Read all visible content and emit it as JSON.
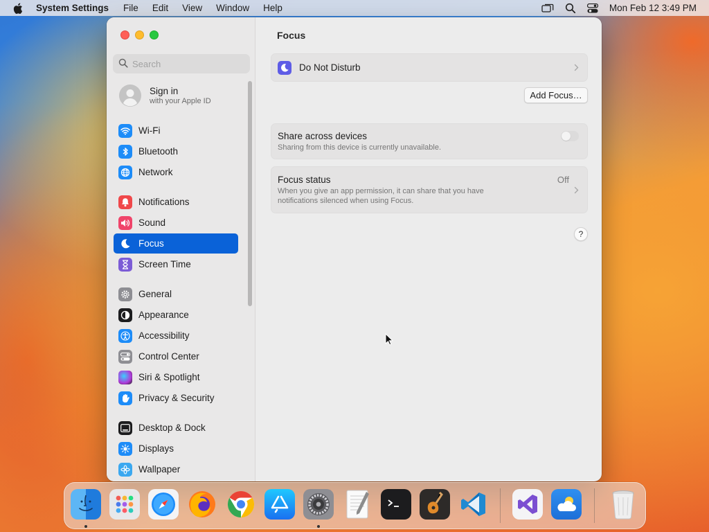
{
  "menubar": {
    "app_name": "System Settings",
    "menus": [
      "File",
      "Edit",
      "View",
      "Window",
      "Help"
    ],
    "clock": "Mon Feb 12  3:49 PM"
  },
  "sidebar": {
    "search_placeholder": "Search",
    "signin": {
      "title": "Sign in",
      "subtitle": "with your Apple ID"
    },
    "items": [
      {
        "label": "Wi-Fi",
        "icon": "wifi-icon",
        "color": "#1d8cf8"
      },
      {
        "label": "Bluetooth",
        "icon": "bluetooth-icon",
        "color": "#1d8cf8"
      },
      {
        "label": "Network",
        "icon": "globe-icon",
        "color": "#1d8cf8"
      },
      {
        "label": "Notifications",
        "icon": "bell-icon",
        "color": "#f0484a"
      },
      {
        "label": "Sound",
        "icon": "speaker-icon",
        "color": "#f0446a"
      },
      {
        "label": "Focus",
        "icon": "moon-icon",
        "color": "#5e5ce6"
      },
      {
        "label": "Screen Time",
        "icon": "hourglass-icon",
        "color": "#7c5cd6"
      },
      {
        "label": "General",
        "icon": "gear-icon",
        "color": "#8e8e93"
      },
      {
        "label": "Appearance",
        "icon": "appearance-icon",
        "color": "#1c1c1e"
      },
      {
        "label": "Accessibility",
        "icon": "accessibility-icon",
        "color": "#1d8cf8"
      },
      {
        "label": "Control Center",
        "icon": "control-center-icon",
        "color": "#8e8e93"
      },
      {
        "label": "Siri & Spotlight",
        "icon": "siri-icon",
        "color": "#b03ad8"
      },
      {
        "label": "Privacy & Security",
        "icon": "hand-icon",
        "color": "#1d8cf8"
      },
      {
        "label": "Desktop & Dock",
        "icon": "dock-icon",
        "color": "#1c1c1e"
      },
      {
        "label": "Displays",
        "icon": "sun-icon",
        "color": "#1d8cf8"
      },
      {
        "label": "Wallpaper",
        "icon": "flower-icon",
        "color": "#3ba8f0"
      }
    ]
  },
  "content": {
    "title": "Focus",
    "dnd_label": "Do Not Disturb",
    "add_focus_label": "Add Focus…",
    "share": {
      "title": "Share across devices",
      "subtitle": "Sharing from this device is currently unavailable.",
      "enabled": false
    },
    "status": {
      "title": "Focus status",
      "value": "Off",
      "subtitle_line1": "When you give an app permission, it can share that you have",
      "subtitle_line2": "notifications silenced when using Focus."
    },
    "help_label": "?"
  },
  "dock": {
    "apps": [
      "Finder",
      "Launchpad",
      "Safari",
      "Firefox",
      "Chrome",
      "App Store",
      "System Settings",
      "TextEdit",
      "Terminal",
      "GarageBand",
      "Visual Studio Code",
      "Visual Studio",
      "Weather",
      "Trash"
    ]
  }
}
